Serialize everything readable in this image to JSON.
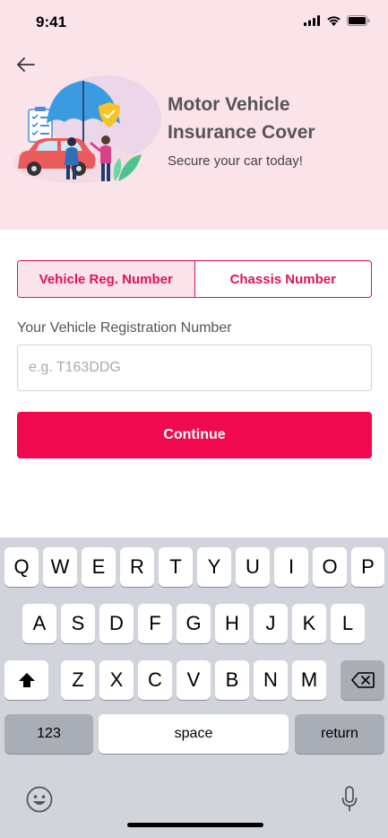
{
  "status_bar": {
    "time": "9:41"
  },
  "header": {
    "title": "Motor Vehicle Insurance Cover",
    "subtitle": "Secure your car today!"
  },
  "tabs": [
    {
      "label": "Vehicle Reg. Number",
      "active": true
    },
    {
      "label": "Chassis Number",
      "active": false
    }
  ],
  "form": {
    "label": "Your Vehicle Registration Number",
    "placeholder": "e.g. T163DDG",
    "value": ""
  },
  "continue_label": "Continue",
  "keyboard": {
    "row1": [
      "Q",
      "W",
      "E",
      "R",
      "T",
      "Y",
      "U",
      "I",
      "O",
      "P"
    ],
    "row2": [
      "A",
      "S",
      "D",
      "F",
      "G",
      "H",
      "J",
      "K",
      "L"
    ],
    "row3": [
      "Z",
      "X",
      "C",
      "V",
      "B",
      "N",
      "M"
    ],
    "numbers_label": "123",
    "space_label": "space",
    "return_label": "return"
  },
  "colors": {
    "accent": "#f0094f",
    "hero_bg": "#fbe3ea",
    "tab_border": "#e0125a"
  },
  "icons": [
    "back-arrow-icon",
    "signal-icon",
    "wifi-icon",
    "battery-icon",
    "shift-icon",
    "backspace-icon",
    "emoji-icon",
    "microphone-icon"
  ]
}
